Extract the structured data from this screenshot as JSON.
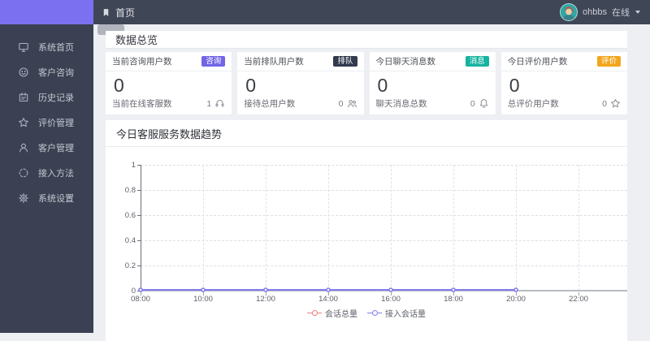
{
  "topbar": {
    "breadcrumb": "首页",
    "breadcrumb_icon": "bookmark-icon",
    "user": {
      "name": "ohbbs",
      "status": "在线",
      "avatar_icon": "avatar-person"
    }
  },
  "sidebar": {
    "accent_color": "#7b70f0",
    "items": [
      {
        "label": "系统首页",
        "icon": "monitor-icon"
      },
      {
        "label": "客户咨询",
        "icon": "chat-smile-icon"
      },
      {
        "label": "历史记录",
        "icon": "history-notebook-icon"
      },
      {
        "label": "评价管理",
        "icon": "star-icon"
      },
      {
        "label": "客户管理",
        "icon": "user-icon"
      },
      {
        "label": "接入方法",
        "icon": "loading-dashed-icon"
      },
      {
        "label": "系统设置",
        "icon": "gear-icon"
      }
    ]
  },
  "overview": {
    "title": "数据总览",
    "cards": [
      {
        "title": "当前咨询用户数",
        "badge": {
          "label": "咨询",
          "color": "#7265e6"
        },
        "value": "0",
        "footer": {
          "label": "当前在线客服数",
          "value": "1",
          "icon": "headset-icon"
        }
      },
      {
        "title": "当前排队用户数",
        "badge": {
          "label": "排队",
          "color": "#323a4d"
        },
        "value": "0",
        "footer": {
          "label": "接待总用户数",
          "value": "0",
          "icon": "team-icon"
        }
      },
      {
        "title": "今日聊天消息数",
        "badge": {
          "label": "消息",
          "color": "#16b3a0"
        },
        "value": "0",
        "footer": {
          "label": "聊天消息总数",
          "value": "0",
          "icon": "bell-icon"
        }
      },
      {
        "title": "今日评价用户数",
        "badge": {
          "label": "评价",
          "color": "#f2a51c"
        },
        "value": "0",
        "footer": {
          "label": "总评价用户数",
          "value": "0",
          "icon": "star-icon"
        }
      }
    ]
  },
  "trend_panel": {
    "title": "今日客服服务数据趋势"
  },
  "chart_data": {
    "type": "line",
    "title": "今日客服服务数据趋势",
    "x_ticks": [
      "08:00",
      "10:00",
      "12:00",
      "14:00",
      "16:00",
      "18:00",
      "20:00",
      "22:00"
    ],
    "y_ticks": [
      0,
      0.2,
      0.4,
      0.6,
      0.8,
      1
    ],
    "ylim": [
      0,
      1
    ],
    "grid": "dashed",
    "legend_position": "bottom",
    "series": [
      {
        "name": "会话总量",
        "color": "#ef7e7e",
        "x": [
          "08:00",
          "10:00",
          "12:00",
          "14:00",
          "16:00",
          "18:00",
          "20:00"
        ],
        "values": [
          0,
          0,
          0,
          0,
          0,
          0,
          0
        ]
      },
      {
        "name": "接入会话量",
        "color": "#817df2",
        "x": [
          "08:00",
          "10:00",
          "12:00",
          "14:00",
          "16:00",
          "18:00",
          "20:00"
        ],
        "values": [
          0,
          0,
          0,
          0,
          0,
          0,
          0
        ]
      }
    ]
  }
}
